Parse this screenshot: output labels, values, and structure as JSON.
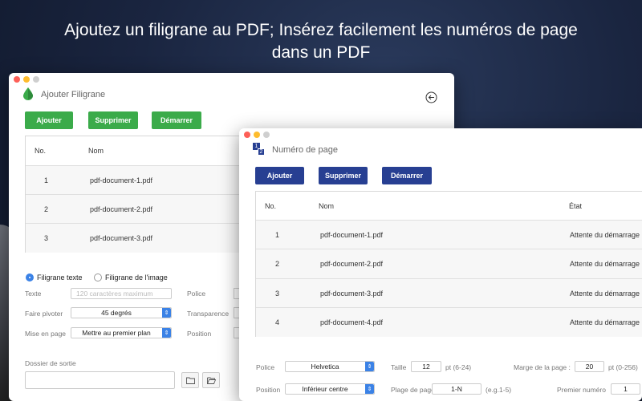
{
  "headline": {
    "line1": "Ajoutez un filigrane au PDF; Insérez facilement les numéros de page",
    "line2": "dans un PDF"
  },
  "colors": {
    "green": "#3bab4a",
    "blue": "#273f92",
    "select_accent": "#3b82e6"
  },
  "watermark_window": {
    "title": "Ajouter Filigrane",
    "title_icon": "water-drop-icon",
    "back_icon": "back-arrow-icon",
    "buttons": {
      "add": "Ajouter",
      "delete": "Supprimer",
      "start": "Démarrer"
    },
    "table": {
      "headers": {
        "no": "No.",
        "name": "Nom"
      },
      "rows": [
        {
          "no": "1",
          "name": "pdf-document-1.pdf"
        },
        {
          "no": "2",
          "name": "pdf-document-2.pdf"
        },
        {
          "no": "3",
          "name": "pdf-document-3.pdf"
        }
      ]
    },
    "radio_text": "Filigrane texte",
    "radio_image": "Filigrane de l'image",
    "text_label": "Texte",
    "text_placeholder": "120 caractères maximum",
    "rotate_label": "Faire pivoter",
    "rotate_value": "45 degrés",
    "layout_label": "Mise en page",
    "layout_value": "Mettre au premier plan",
    "font_label": "Police",
    "transparency_label": "Transparence",
    "position_label": "Position",
    "output_label": "Dossier de sortie",
    "folder_icon": "folder-icon",
    "open_folder_icon": "open-folder-icon"
  },
  "page_number_window": {
    "title": "Numéro de page",
    "title_icon": "page-number-icon",
    "icon_digits": {
      "one": "1",
      "two": "2"
    },
    "buttons": {
      "add": "Ajouter",
      "delete": "Supprimer",
      "start": "Démarrer"
    },
    "table": {
      "headers": {
        "no": "No.",
        "name": "Nom",
        "state": "État"
      },
      "rows": [
        {
          "no": "1",
          "name": "pdf-document-1.pdf",
          "state": "Attente du démarrage"
        },
        {
          "no": "2",
          "name": "pdf-document-2.pdf",
          "state": "Attente du démarrage"
        },
        {
          "no": "3",
          "name": "pdf-document-3.pdf",
          "state": "Attente du démarrage"
        },
        {
          "no": "4",
          "name": "pdf-document-4.pdf",
          "state": "Attente du démarrage"
        }
      ]
    },
    "font_label": "Police",
    "font_value": "Helvetica",
    "size_label": "Taille",
    "size_value": "12",
    "size_hint": "pt (6-24)",
    "margin_label": "Marge de la page :",
    "margin_value": "20",
    "margin_hint": "pt (0-256)",
    "position_label": "Position",
    "position_value": "Inférieur centre",
    "range_label": "Plage de pages",
    "range_value": "1-N",
    "range_hint": "(e.g.1-5)",
    "first_number_label": "Premier numéro",
    "first_number_value": "1"
  }
}
